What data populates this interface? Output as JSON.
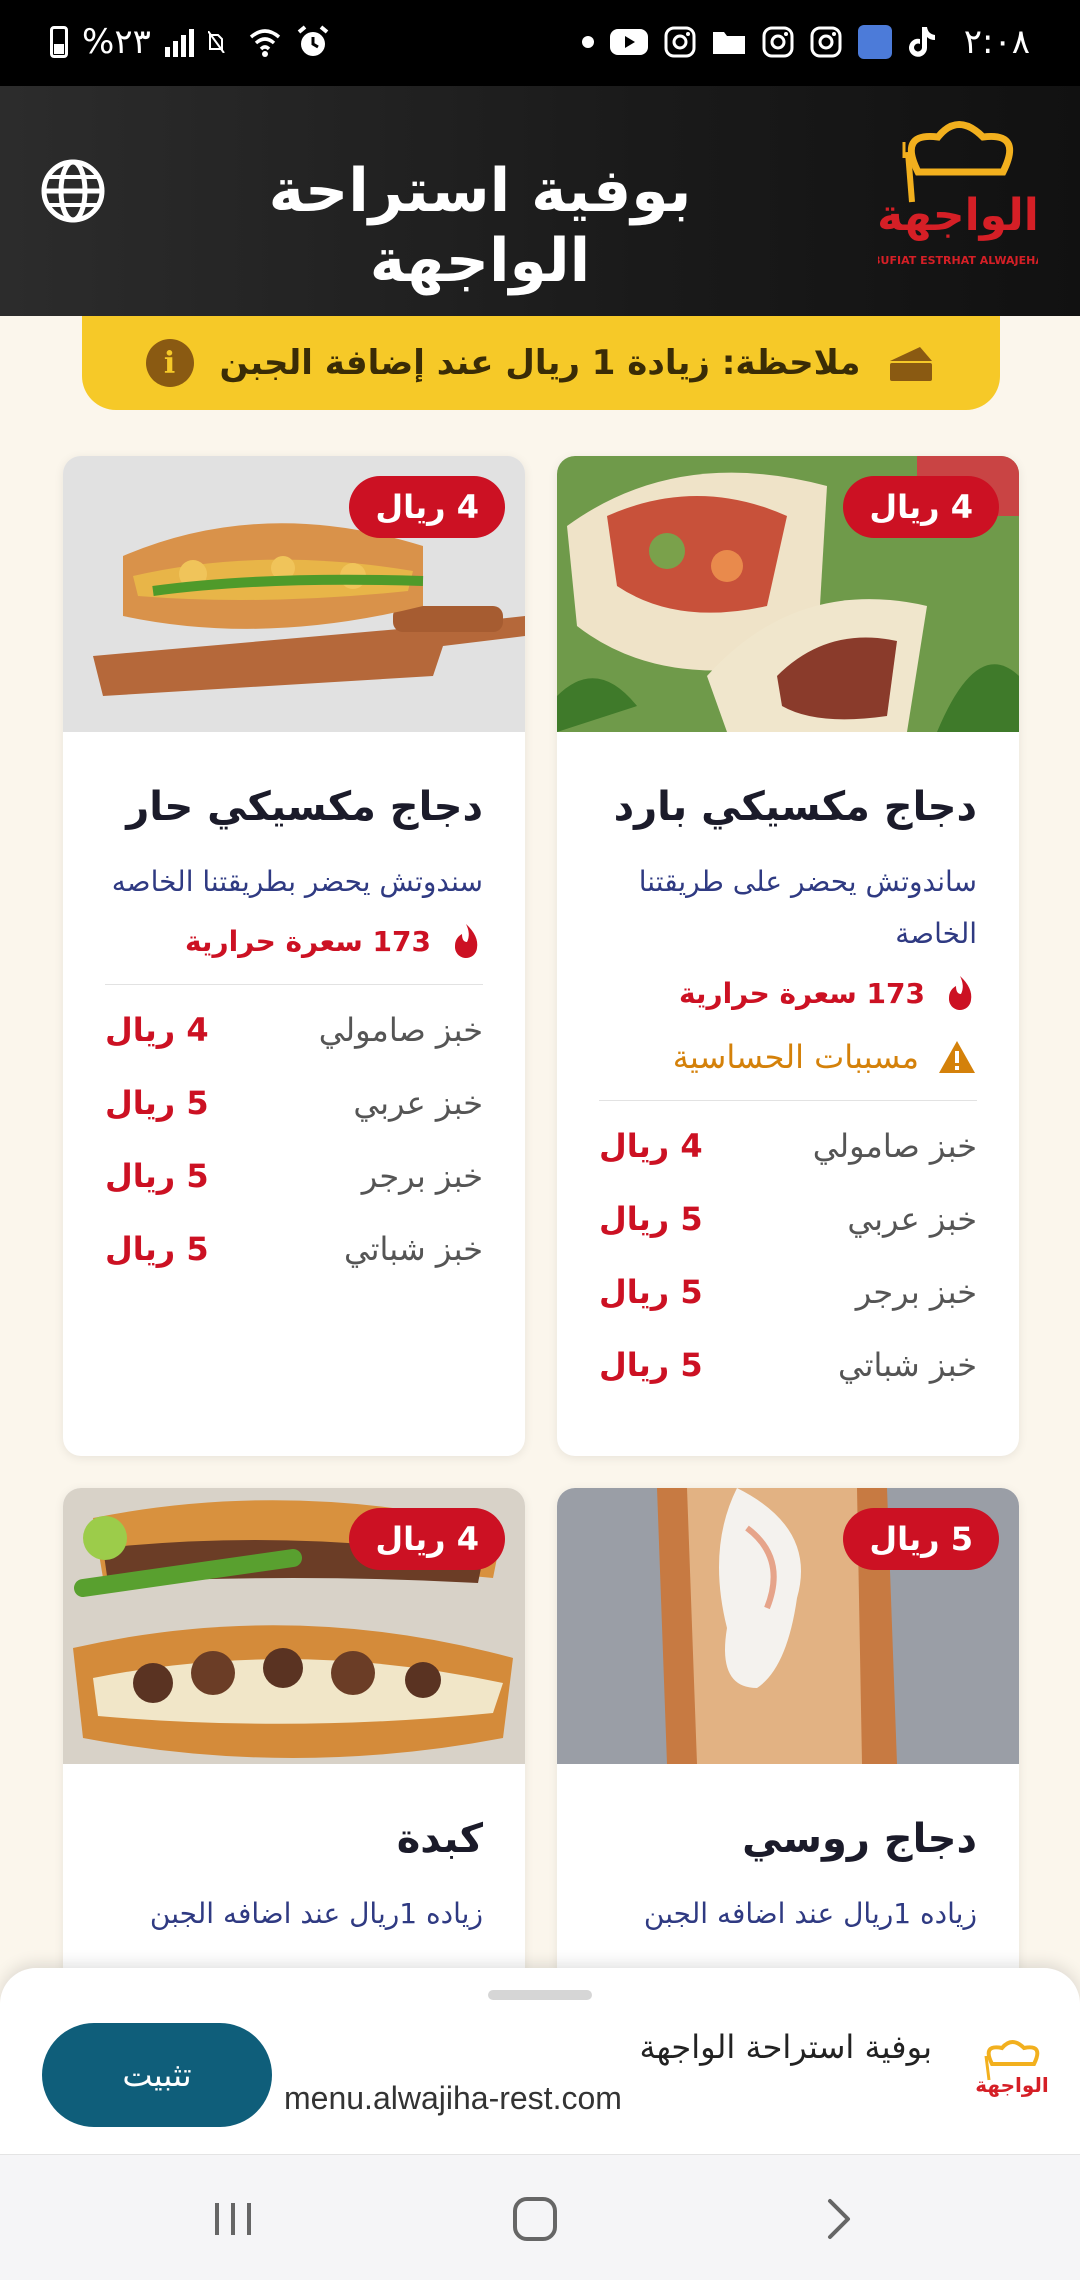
{
  "status_bar": {
    "time": "٢:٠٨",
    "battery": "%٢٣",
    "left_icons": [
      "battery-icon",
      "signal-icon",
      "no-sim-icon",
      "wifi-icon",
      "alarm-icon"
    ],
    "right_icons": [
      "dot-icon",
      "youtube-icon",
      "instagram-icon",
      "folder-icon",
      "instagram-icon",
      "instagram-icon",
      "app-icon",
      "tiktok-icon"
    ]
  },
  "header": {
    "title": "بوفية استراحة الواجهة",
    "logo_text": "الواجهة",
    "logo_subtext": "BUFIAT ESTRHAT ALWAJEHA",
    "language_icon": "globe-icon"
  },
  "notice": {
    "text": "ملاحظة: زيادة 1 ريال عند إضافة الجبن",
    "icon_left": "info-icon",
    "icon_right": "cheese-icon"
  },
  "colors": {
    "accent_red": "#cc1123",
    "notice_yellow": "#f6c928",
    "install_teal": "#0f5e7a",
    "desc_blue": "#2f3a82",
    "allergen_orange": "#d4810a"
  },
  "cards": [
    {
      "price": "4 ريال",
      "title": "دجاج مكسيكي بارد",
      "description": "ساندوتش يحضر على طريقتنا الخاصة",
      "calories": "173 سعرة حرارية",
      "allergens": "مسببات الحساسية",
      "options": [
        {
          "name": "خبز صامولي",
          "price": "4 ريال"
        },
        {
          "name": "خبز عربي",
          "price": "5 ريال"
        },
        {
          "name": "خبز برجر",
          "price": "5 ريال"
        },
        {
          "name": "خبز شباتي",
          "price": "5 ريال"
        }
      ]
    },
    {
      "price": "4 ريال",
      "title": "دجاج مكسيكي حار",
      "description": "سندوتش يحضر بطريقتنا الخاصه",
      "calories": "173 سعرة حرارية",
      "options": [
        {
          "name": "خبز صامولي",
          "price": "4 ريال"
        },
        {
          "name": "خبز عربي",
          "price": "5 ريال"
        },
        {
          "name": "خبز برجر",
          "price": "5 ريال"
        },
        {
          "name": "خبز شباتي",
          "price": "5 ريال"
        }
      ]
    },
    {
      "price": "5 ريال",
      "title": "دجاج روسي",
      "description": "زياده 1ريال عند اضافه الجبن"
    },
    {
      "price": "4 ريال",
      "title": "كبدة",
      "description": "زياده 1ريال عند اضافه الجبن"
    }
  ],
  "install_sheet": {
    "app_name": "بوفية استراحة الواجهة",
    "url": "menu.alwajiha-rest.com",
    "install_label": "تثبيت"
  },
  "nav_bar": {
    "buttons": [
      "recent-apps-icon",
      "home-icon",
      "back-icon"
    ]
  }
}
